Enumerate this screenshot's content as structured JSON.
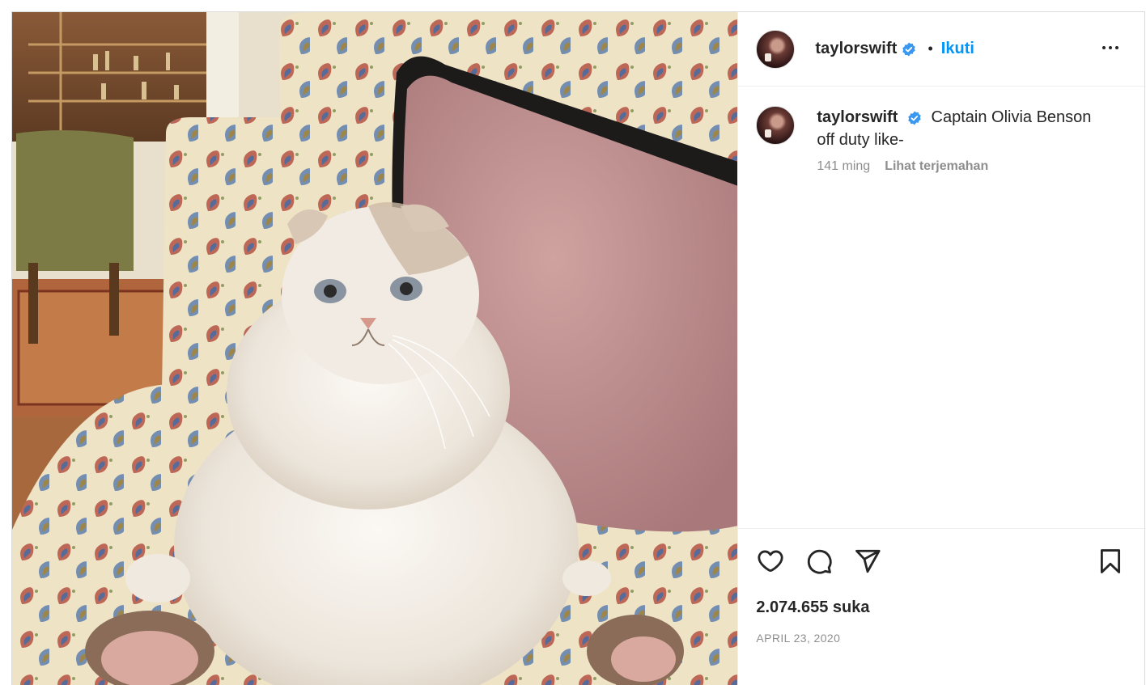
{
  "post": {
    "media": {
      "alt_icon": "photo-cat-on-sofa"
    },
    "header": {
      "username": "taylorswift",
      "separator": "•",
      "follow_label": "Ikuti",
      "more_icon": "more-horizontal-icon",
      "verified_icon": "verified-badge-icon"
    },
    "caption": {
      "username": "taylorswift",
      "text": "Captain Olivia Benson off duty like-",
      "age": "141 ming",
      "translate_label": "Lihat terjemahan"
    },
    "actions": {
      "like_icon": "heart-icon",
      "comment_icon": "comment-icon",
      "share_icon": "send-icon",
      "save_icon": "bookmark-icon"
    },
    "likes": "2.074.655 suka",
    "date": "APRIL 23, 2020"
  },
  "colors": {
    "accent": "#0095f6",
    "text": "#262626",
    "muted": "#8e8e8e",
    "verified": "#3897f0",
    "border": "#dbdbdb"
  }
}
